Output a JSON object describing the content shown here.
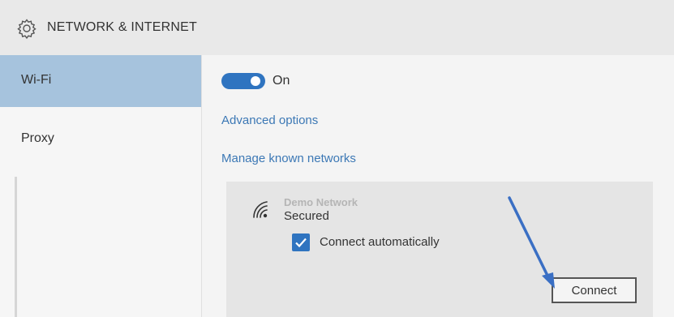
{
  "header": {
    "title": "NETWORK & INTERNET",
    "icon": "gear-icon"
  },
  "sidebar": {
    "items": [
      {
        "label": "Wi-Fi",
        "active": true
      },
      {
        "label": "Proxy",
        "active": false
      }
    ]
  },
  "main": {
    "wifi_toggle": {
      "label": "On",
      "state": true
    },
    "links": {
      "advanced": "Advanced options",
      "manage": "Manage known networks"
    },
    "network": {
      "name": "Demo Network",
      "status": "Secured",
      "icon": "wifi-signal-icon",
      "auto_connect": {
        "label": "Connect automatically",
        "checked": true
      },
      "connect_button": "Connect"
    }
  },
  "annotation": {
    "arrow_color": "#3a6fc4"
  },
  "colors": {
    "accent": "#2f74c0",
    "sidebar_active": "#a6c3dd",
    "link": "#3c78b5"
  }
}
